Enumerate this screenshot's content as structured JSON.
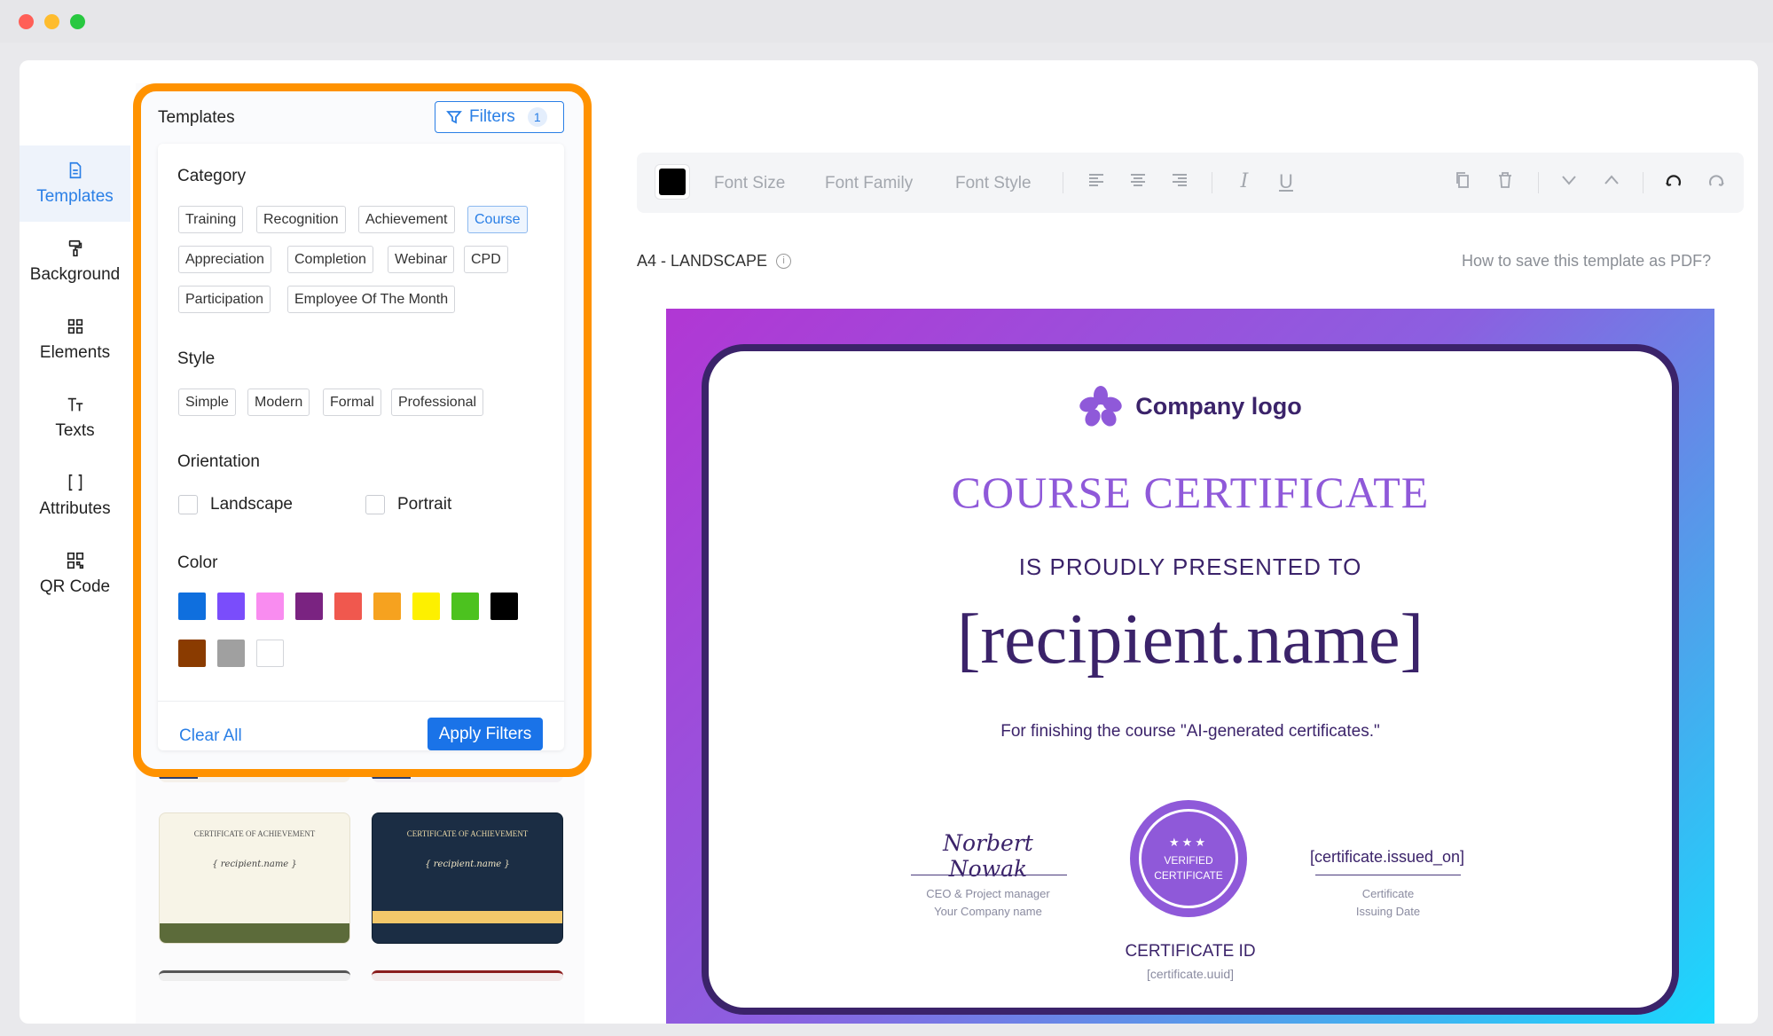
{
  "window": {
    "controls": {
      "close": "#ff5f57",
      "minimize": "#febc2e",
      "maximize": "#28c840"
    }
  },
  "sidebar": {
    "items": [
      {
        "label": "Templates",
        "icon": "template-icon"
      },
      {
        "label": "Background",
        "icon": "paint-roller-icon"
      },
      {
        "label": "Elements",
        "icon": "elements-icon"
      },
      {
        "label": "Texts",
        "icon": "text-icon"
      },
      {
        "label": "Attributes",
        "icon": "brackets-icon"
      },
      {
        "label": "QR Code",
        "icon": "qr-code-icon"
      }
    ]
  },
  "panel": {
    "title": "Templates",
    "filters_label": "Filters",
    "filters_count": "1"
  },
  "filters": {
    "category_title": "Category",
    "categories": [
      "Training",
      "Recognition",
      "Achievement",
      "Course",
      "Appreciation",
      "Completion",
      "Webinar",
      "CPD",
      "Participation",
      "Employee Of The Month"
    ],
    "selected_category": "Course",
    "style_title": "Style",
    "styles": [
      "Simple",
      "Modern",
      "Formal",
      "Professional"
    ],
    "orientation_title": "Orientation",
    "orientations": [
      "Landscape",
      "Portrait"
    ],
    "color_title": "Color",
    "colors": [
      "#0f6fde",
      "#7a4dfb",
      "#f98cf0",
      "#7a2381",
      "#f0584e",
      "#f6a21f",
      "#fdf000",
      "#4cc21f",
      "#000000",
      "#8a3b00",
      "#a0a0a0",
      "#ffffff"
    ],
    "clear_label": "Clear All",
    "apply_label": "Apply Filters"
  },
  "toolbar": {
    "font_size": "Font Size",
    "font_family": "Font Family",
    "font_style": "Font Style",
    "color": "#000000"
  },
  "canvas": {
    "page_size": "A4 - LANDSCAPE",
    "howto": "How to save this template as PDF?"
  },
  "certificate": {
    "logo_text": "Company logo",
    "title": "COURSE CERTIFICATE",
    "presented": "IS PROUDLY PRESENTED TO",
    "name": "[recipient.name]",
    "for_text": "For finishing the course \"AI-generated certificates.\"",
    "signature": "Norbert Nowak",
    "signer_role": "CEO & Project manager",
    "signer_company": "Your Company name",
    "seal_top": "VERIFIED",
    "seal_bottom": "CERTIFICATE",
    "cert_id_label": "CERTIFICATE ID",
    "cert_id_value": "[certificate.uuid]",
    "issued_on": "[certificate.issued_on]",
    "issued_label_1": "Certificate",
    "issued_label_2": "Issuing Date",
    "accent": "#8f59d9",
    "dark": "#3b236a"
  },
  "thumbnails": [
    {
      "title": "CERTIFICATE OF ACHIEVEMENT",
      "name": "{ recipient.name }"
    },
    {
      "title": "CERTIFICATE OF ACHIEVEMENT",
      "name": "{ recipient.name }"
    }
  ]
}
